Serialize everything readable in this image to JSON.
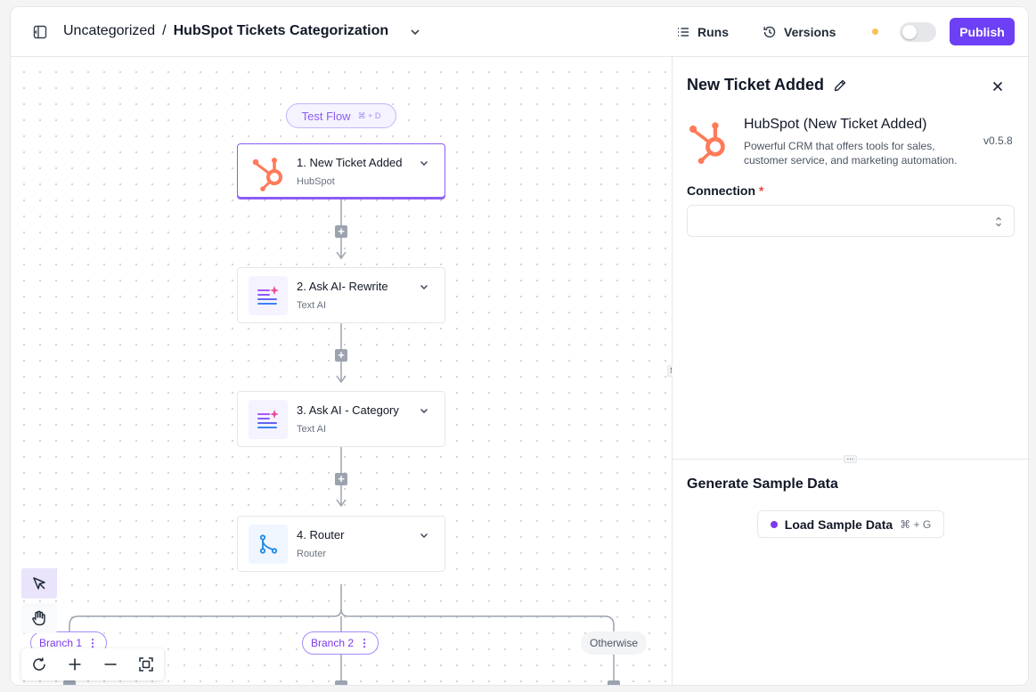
{
  "header": {
    "folder": "Uncategorized",
    "separator": "/",
    "flow_name": "HubSpot Tickets Categorization",
    "runs_label": "Runs",
    "versions_label": "Versions",
    "publish_label": "Publish",
    "status_dot_color": "#f5c451",
    "toggle_enabled": false
  },
  "colors": {
    "accent": "#6d3ff5",
    "hubspot": "#ff7a59",
    "router": "#1e88e5"
  },
  "canvas": {
    "test_flow": {
      "label": "Test Flow",
      "shortcut": "⌘ + D"
    },
    "steps": [
      {
        "title": "1. New Ticket Added",
        "subtitle": "HubSpot",
        "icon": "hubspot-icon",
        "selected": true
      },
      {
        "title": "2. Ask AI- Rewrite",
        "subtitle": "Text AI",
        "icon": "text-ai-icon",
        "selected": false
      },
      {
        "title": "3. Ask AI - Category",
        "subtitle": "Text AI",
        "icon": "text-ai-icon",
        "selected": false
      },
      {
        "title": "4. Router",
        "subtitle": "Router",
        "icon": "router-icon",
        "selected": false
      }
    ],
    "branches": [
      {
        "label": "Branch 1",
        "menu": "⋮"
      },
      {
        "label": "Branch 2",
        "menu": "⋮"
      }
    ],
    "otherwise_label": "Otherwise",
    "tools": [
      "select-pointer-icon",
      "hand-pan-icon"
    ],
    "zoom_controls": [
      "reset-view-icon",
      "zoom-in-icon",
      "zoom-out-icon",
      "fit-view-icon"
    ]
  },
  "panel": {
    "title": "New Ticket Added",
    "piece_name": "HubSpot (New Ticket Added)",
    "piece_description": "Powerful CRM that offers tools for sales, customer service, and marketing automation.",
    "piece_version": "v0.5.8",
    "connection_label": "Connection",
    "required_mark": "*",
    "connection_value": "",
    "sample_title": "Generate Sample Data",
    "load_label": "Load Sample Data",
    "load_shortcut": "⌘ + G"
  }
}
